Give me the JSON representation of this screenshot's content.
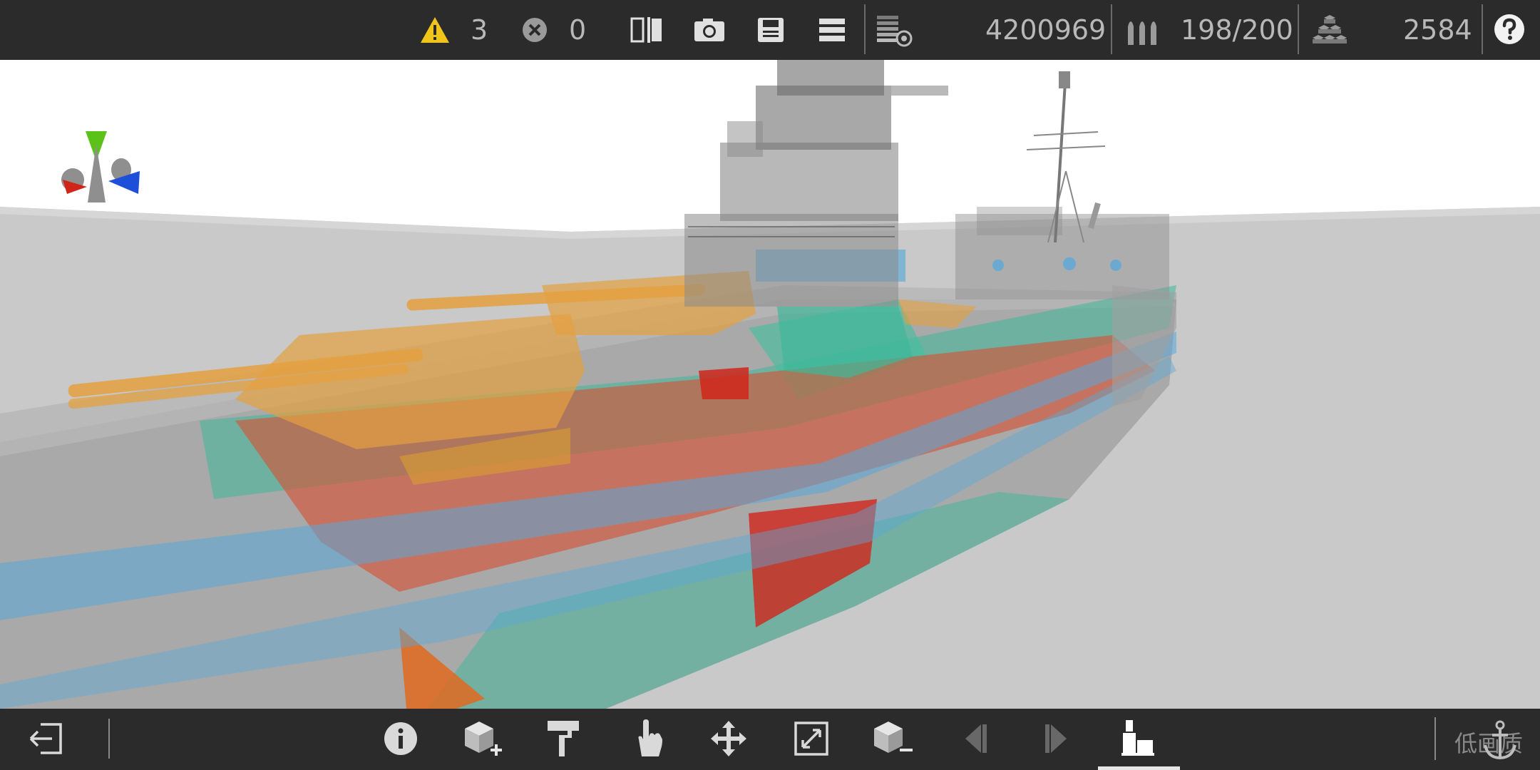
{
  "top": {
    "warnings_count": "3",
    "errors_count": "0",
    "cost": "4200969",
    "ammo": "198/200",
    "parts": "2584"
  },
  "bottom": {
    "quality_label": "低画质"
  },
  "colors": {
    "bar_bg": "#2b2b2b",
    "warning": "#f0c419",
    "armor_orange": "#e4a040",
    "armor_red": "#d85030",
    "armor_teal": "#40b89a",
    "armor_blue": "#5aa8d8",
    "axis_green": "#5cc21a",
    "axis_red": "#d0261a",
    "axis_blue": "#1e4fd8"
  },
  "icons": {
    "top": [
      "warning-icon",
      "error-icon",
      "split-view-icon",
      "camera-icon",
      "save-icon",
      "menu-icon",
      "layers-icon",
      "ammo-icon",
      "parts-icon",
      "help-icon"
    ],
    "bottom": [
      "exit-icon",
      "info-icon",
      "add-part-icon",
      "paint-icon",
      "select-icon",
      "move-icon",
      "scale-icon",
      "remove-part-icon",
      "prev-icon",
      "next-icon",
      "ship-view-icon",
      "anchor-icon"
    ]
  }
}
